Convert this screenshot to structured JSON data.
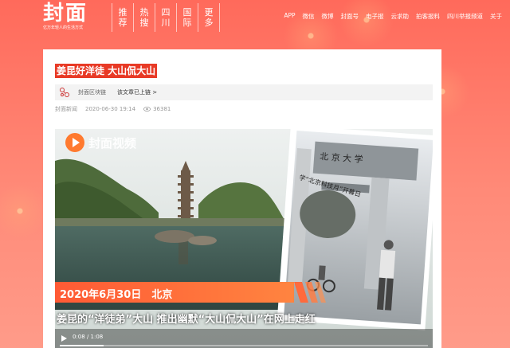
{
  "header": {
    "logo": {
      "title": "封面",
      "tagline": "亿万年轻人的生活方式"
    },
    "nav": [
      {
        "label": "推荐"
      },
      {
        "label": "热搜"
      },
      {
        "label": "四川"
      },
      {
        "label": "国际"
      },
      {
        "label": "更多"
      }
    ],
    "links": [
      "APP",
      "微信",
      "微博",
      "封面号",
      "电子报",
      "云求助",
      "拍客报料",
      "四川举报频道",
      "关于"
    ]
  },
  "article": {
    "title": "姜昆好洋徒 大山侃大山",
    "chain": {
      "text": "封面区块链",
      "link": "该文章已上链 >"
    },
    "meta": {
      "source": "封面新闻",
      "datetime": "2020-06-30 19:14",
      "views": "36381"
    }
  },
  "video": {
    "logo": "封面视频",
    "date": "2020年6月30日　北京",
    "caption": "姜昆的“洋徒弟”大山 推出幽默“大山侃大山”在网上走红",
    "time": "0:08 / 1:08",
    "progress": 0.12,
    "gate_sign": "北 京 大 学",
    "gate_banner": "学“北京科技月”开幕日"
  },
  "colors": {
    "brand_red": "#e83a26",
    "banner_orange": "#ff6a3d"
  }
}
